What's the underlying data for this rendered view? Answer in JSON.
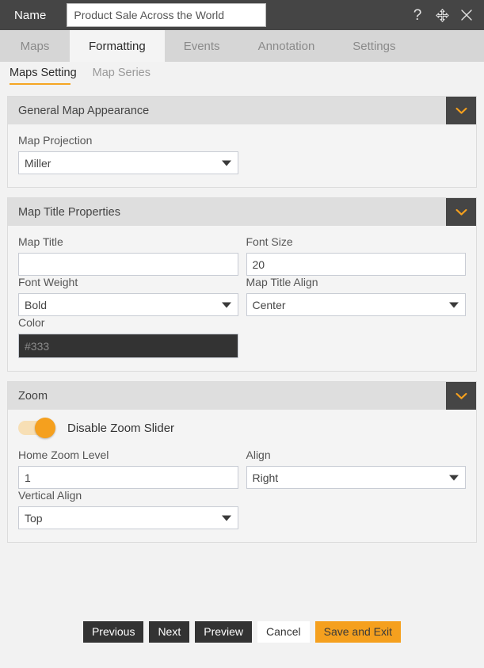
{
  "titlebar": {
    "name_label": "Name",
    "name_value": "Product Sale Across the World",
    "name_placeholder": "Name",
    "help_icon": "question-mark-icon",
    "move_icon": "move-arrows-icon",
    "close_icon": "close-icon"
  },
  "tabs": [
    {
      "label": "Maps",
      "active": false
    },
    {
      "label": "Formatting",
      "active": true
    },
    {
      "label": "Events",
      "active": false
    },
    {
      "label": "Annotation",
      "active": false
    },
    {
      "label": "Settings",
      "active": false
    }
  ],
  "subtabs": [
    {
      "label": "Maps Setting",
      "active": true
    },
    {
      "label": "Map Series",
      "active": false
    }
  ],
  "sections": {
    "general_map_appearance": {
      "title": "General Map Appearance",
      "collapse_icon": "chevron-down-icon",
      "map_projection": {
        "label": "Map Projection",
        "value": "Miller"
      }
    },
    "map_title_properties": {
      "title": "Map Title Properties",
      "collapse_icon": "chevron-down-icon",
      "map_title": {
        "label": "Map Title",
        "value": "",
        "placeholder": ""
      },
      "font_size": {
        "label": "Font Size",
        "value": "20"
      },
      "font_weight": {
        "label": "Font Weight",
        "value": "Bold"
      },
      "map_title_align": {
        "label": "Map Title Align",
        "value": "Center"
      },
      "color": {
        "label": "Color",
        "value": "",
        "placeholder": "#333",
        "swatch": "#333333"
      }
    },
    "zoom": {
      "title": "Zoom",
      "collapse_icon": "chevron-down-icon",
      "disable_zoom_slider": {
        "label": "Disable Zoom Slider",
        "on": true
      },
      "home_zoom_level": {
        "label": "Home Zoom Level",
        "value": "1"
      },
      "align": {
        "label": "Align",
        "value": "Right"
      },
      "vertical_align": {
        "label": "Vertical Align",
        "value": "Top"
      }
    }
  },
  "footer": {
    "previous": "Previous",
    "next": "Next",
    "preview": "Preview",
    "cancel": "Cancel",
    "save_and_exit": "Save and Exit"
  },
  "colors": {
    "accent": "#f5a01e",
    "titlebar_bg": "#454545",
    "panel_header_bg": "#dedede"
  }
}
